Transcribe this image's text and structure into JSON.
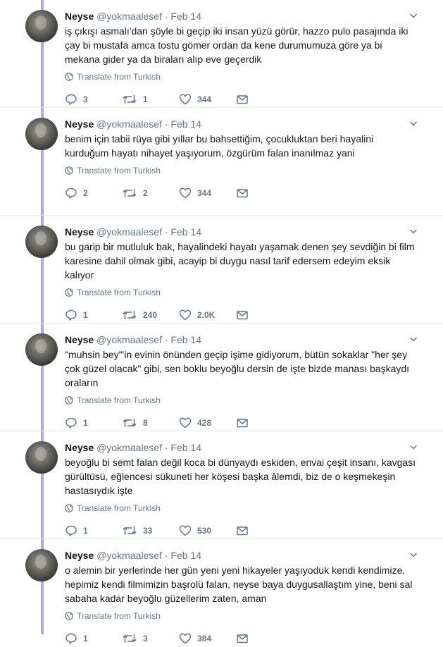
{
  "tweets": [
    {
      "name": "Neyse",
      "handle": "@yokmaalesef",
      "sep": "·",
      "date": "Feb 14",
      "text": "iş çıkışı asmalı'dan şöyle bi geçip iki insan yüzü görür, hazzo pulo pasajında iki çay bi mustafa amca tostu gömer ordan da kene durumumuza göre ya bi mekana gider ya da biraları alıp eve geçerdik",
      "translate": "Translate from Turkish",
      "replies": "3",
      "retweets": "1",
      "likes": "344"
    },
    {
      "name": "Neyse",
      "handle": "@yokmaalesef",
      "sep": "·",
      "date": "Feb 14",
      "text": "benim için tabii rüya gibi yıllar bu bahsettiğim, çocukluktan beri hayalini kurduğum hayatı nihayet yaşıyorum, özgürüm falan inanılmaz yani",
      "translate": "Translate from Turkish",
      "replies": "2",
      "retweets": "2",
      "likes": "344"
    },
    {
      "name": "Neyse",
      "handle": "@yokmaalesef",
      "sep": "·",
      "date": "Feb 14",
      "text": "bu garip bir mutluluk bak, hayalindeki hayatı yaşamak denen şey sevdiğin bi film karesine dahil olmak gibi, acayip bi duygu nasıl tarif edersem edeyim eksik kalıyor",
      "translate": "Translate from Turkish",
      "replies": "1",
      "retweets": "240",
      "likes": "2.0K"
    },
    {
      "name": "Neyse",
      "handle": "@yokmaalesef",
      "sep": "·",
      "date": "Feb 14",
      "text": "\"muhsin bey\"'in evinin önünden geçip işime gidiyorum, bütün sokaklar \"her şey çok güzel olacak\" gibi, sen boklu beyoğlu dersin de işte bizde manası başkaydı oraların",
      "translate": "Translate from Turkish",
      "replies": "1",
      "retweets": "8",
      "likes": "428"
    },
    {
      "name": "Neyse",
      "handle": "@yokmaalesef",
      "sep": "·",
      "date": "Feb 14",
      "text": "beyoğlu bi semt falan değil koca bi dünyaydı eskiden, envai çeşit insanı, kavgası gürültüsü, eğlencesi sükuneti her köşesi başka âlemdi, biz de o keşmekeşin hastasıydık işte",
      "translate": "Translate from Turkish",
      "replies": "1",
      "retweets": "33",
      "likes": "530"
    },
    {
      "name": "Neyse",
      "handle": "@yokmaalesef",
      "sep": "·",
      "date": "Feb 14",
      "text": "o alemin bir yerlerinde her gün yeni yeni hikayeler yaşıyoduk kendi kendimize, hepimiz kendi filmimizin başrolü falan, neyse baya duygusallaştım yine, beni sal sabaha kadar beyoğlu güzellerim zaten, aman",
      "translate": "Translate from Turkish",
      "replies": "1",
      "retweets": "3",
      "likes": "384"
    }
  ],
  "icons": {
    "reply": "reply-icon",
    "retweet": "retweet-icon",
    "like": "heart-icon",
    "dm": "envelope-icon",
    "globe": "globe-icon",
    "more": "chevron-down-icon"
  },
  "colors": {
    "thread_line": "#b0a8e0",
    "meta_gray": "#657786",
    "text": "#14171a"
  }
}
